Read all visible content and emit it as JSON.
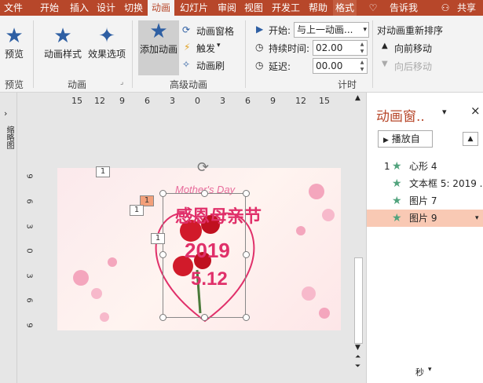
{
  "tabs": [
    "文件",
    "开始",
    "插入",
    "设计",
    "切换",
    "动画",
    "幻灯片",
    "审阅",
    "视图",
    "开发工",
    "帮助",
    "格式"
  ],
  "tab_extra": {
    "tell": "告诉我",
    "share": "共享"
  },
  "ribbon": {
    "preview_label": "预览",
    "preview_group": "预览",
    "style_label": "动画样式",
    "effect_label": "效果选项",
    "anim_group": "动画",
    "add_anim_label": "添加动画",
    "anim_pane_label": "动画窗格",
    "trigger_label": "触发",
    "brush_label": "动画刷",
    "adv_group": "高级动画",
    "start_label": "开始:",
    "start_value": "与上一动画...",
    "duration_label": "持续时间:",
    "duration_value": "02.00",
    "delay_label": "延迟:",
    "delay_value": "00.00",
    "timing_group": "计时",
    "reorder_label": "对动画重新排序",
    "move_earlier": "向前移动",
    "move_later": "向后移动"
  },
  "ruler": [
    "15",
    "12",
    "9",
    "6",
    "3",
    "0",
    "3",
    "6",
    "9",
    "12",
    "15"
  ],
  "vruler": [
    "9",
    "6",
    "3",
    "0",
    "3",
    "6",
    "9"
  ],
  "left_strip_label": "缩略图",
  "slide": {
    "title_top": "Mother's Day",
    "title": "感恩母亲节",
    "year": "2019",
    "date": "5.12"
  },
  "tags": [
    "1",
    "1",
    "1",
    "1"
  ],
  "pane": {
    "title": "动画窗..",
    "play_label": "播放自",
    "items": [
      {
        "num": "1",
        "label": "心形 4"
      },
      {
        "num": "",
        "label": "文本框 5: 2019 ..."
      },
      {
        "num": "",
        "label": "图片 7"
      },
      {
        "num": "",
        "label": "图片 9"
      }
    ],
    "footer": "秒"
  },
  "colors": {
    "accent": "#b7472a",
    "star": "#2e5fa3",
    "green": "#51a37d",
    "selection": "#f9c9b4"
  }
}
